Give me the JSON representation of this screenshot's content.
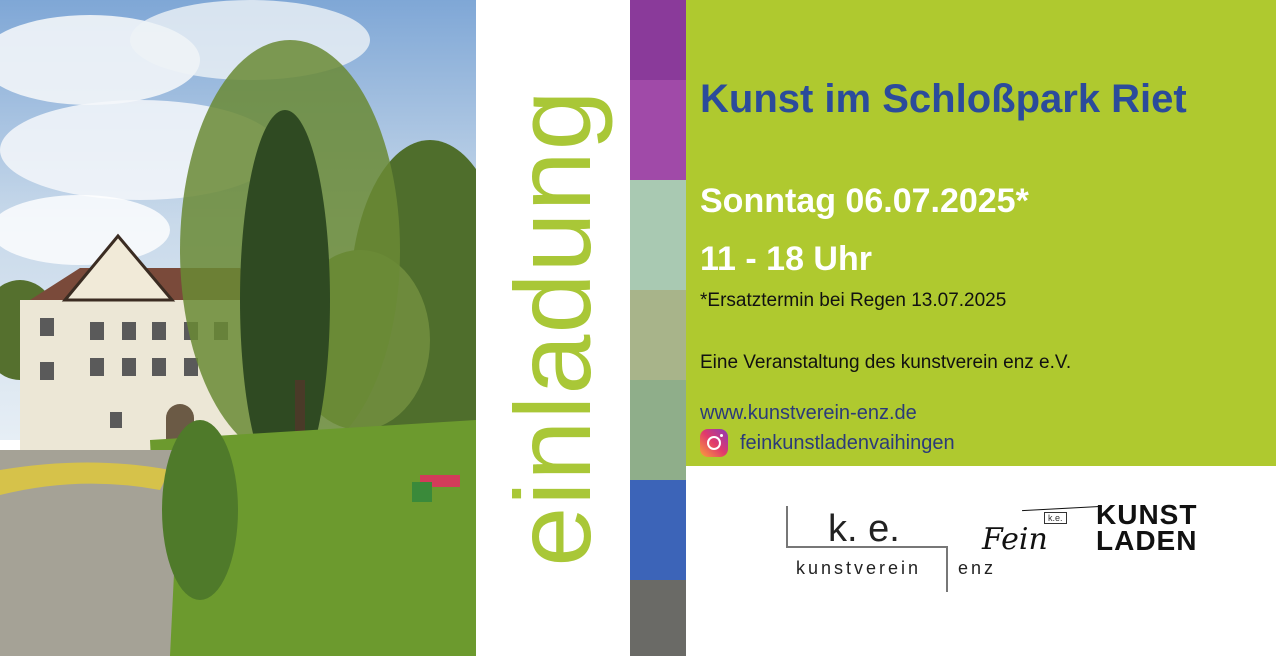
{
  "vertical_text": "einladung",
  "title": "Kunst im Schloßpark Riet",
  "date_line": "Sonntag 06.07.2025*",
  "time_line": "11 - 18 Uhr",
  "rain_note": "*Ersatztermin bei Regen 13.07.2025",
  "organizer": "Eine Veranstaltung des kunstverein enz e.V.",
  "website": "www.kunstverein-enz.de",
  "instagram_handle": "feinkunstladenvaihingen",
  "logos": {
    "ke_letters": "k. e.",
    "ke_word": "kunstverein",
    "ke_word2": "enz",
    "fein_script": "Fein",
    "fein_mini": "k.e.",
    "kunst": "KUNST",
    "laden": "LADEN"
  },
  "colors": {
    "accent_green": "#afc92f",
    "title_blue": "#2b4b9b",
    "vertical_green": "#a9c737"
  },
  "icons": [
    "instagram-icon"
  ]
}
